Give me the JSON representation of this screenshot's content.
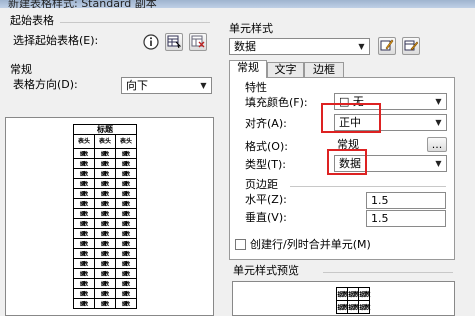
{
  "window": {
    "title": "新建表格样式: Standard 副本"
  },
  "left": {
    "start_table": {
      "heading": "起始表格",
      "select_label": "选择起始表格(E):"
    },
    "general": {
      "heading": "常规",
      "direction_label": "表格方向(D):",
      "direction_value": "向下"
    },
    "preview": {
      "title": "标题",
      "header": [
        "表头",
        "表头",
        "表头"
      ],
      "cell": "数据",
      "rows": 16
    }
  },
  "right": {
    "cell_style": {
      "heading": "单元样式",
      "value": "数据"
    },
    "tabs": [
      "常规",
      "文字",
      "边框"
    ],
    "properties": {
      "heading": "特性",
      "fill_label": "填充颜色(F):",
      "fill_value": "□ 无",
      "align_label": "对齐(A):",
      "align_value": "正中",
      "format_label": "格式(O):",
      "format_value": "常规",
      "format_button": "...",
      "type_label": "类型(T):",
      "type_value": "数据"
    },
    "margins": {
      "heading": "页边距",
      "horizontal_label": "水平(Z):",
      "horizontal_value": "1.5",
      "vertical_label": "垂直(V):",
      "vertical_value": "1.5"
    },
    "merge_checkbox_label": "创建行/列时合并单元(M)",
    "style_preview_heading": "单元样式预览",
    "style_preview_cell": "数据"
  },
  "colors": {
    "highlight": "#d22222"
  },
  "icons": [
    "info-icon",
    "select-table-icon",
    "remove-table-icon",
    "new-cell-style-icon",
    "manage-cell-styles-icon"
  ]
}
